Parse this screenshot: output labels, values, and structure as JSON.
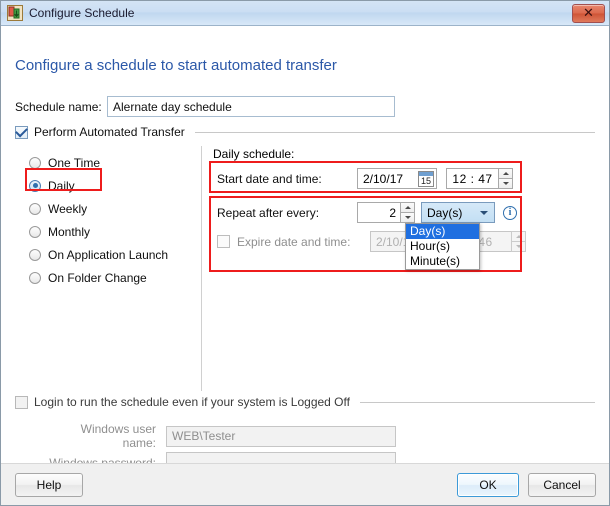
{
  "window": {
    "title": "Configure Schedule",
    "icon": "schedule-app-icon",
    "close_label": "✕"
  },
  "heading": "Configure a schedule to start automated transfer",
  "schedule_name": {
    "label": "Schedule name:",
    "value": "Alernate day schedule"
  },
  "perform_transfer": {
    "label": "Perform Automated Transfer",
    "checked": true
  },
  "frequency_options": [
    {
      "label": "One Time",
      "selected": false
    },
    {
      "label": "Daily",
      "selected": true
    },
    {
      "label": "Weekly",
      "selected": false
    },
    {
      "label": "Monthly",
      "selected": false
    },
    {
      "label": "On Application Launch",
      "selected": false
    },
    {
      "label": "On Folder Change",
      "selected": false
    }
  ],
  "daily": {
    "title": "Daily schedule:",
    "start": {
      "label": "Start date and time:",
      "date": "2/10/17",
      "calendar_day": "15",
      "time": "12 : 47"
    },
    "repeat": {
      "label": "Repeat after every:",
      "value": "2",
      "unit_selected": "Day(s)",
      "unit_options": [
        "Day(s)",
        "Hour(s)",
        "Minute(s)"
      ],
      "info_glyph": "i"
    },
    "expire": {
      "label": "Expire date and time:",
      "checked": false,
      "date": "2/10/18",
      "time": "46"
    }
  },
  "login": {
    "label": "Login to run the schedule even if your system is Logged Off",
    "checked": false,
    "username_label": "Windows user name:",
    "username_value": "WEB\\Tester",
    "password_label": "Windows password:",
    "password_value": ""
  },
  "footer": {
    "help": "Help",
    "ok": "OK",
    "cancel": "Cancel"
  },
  "colors": {
    "accent_blue": "#2b58a8",
    "highlight_red": "#ee1c1c",
    "selection_blue": "#1f6fe0"
  }
}
